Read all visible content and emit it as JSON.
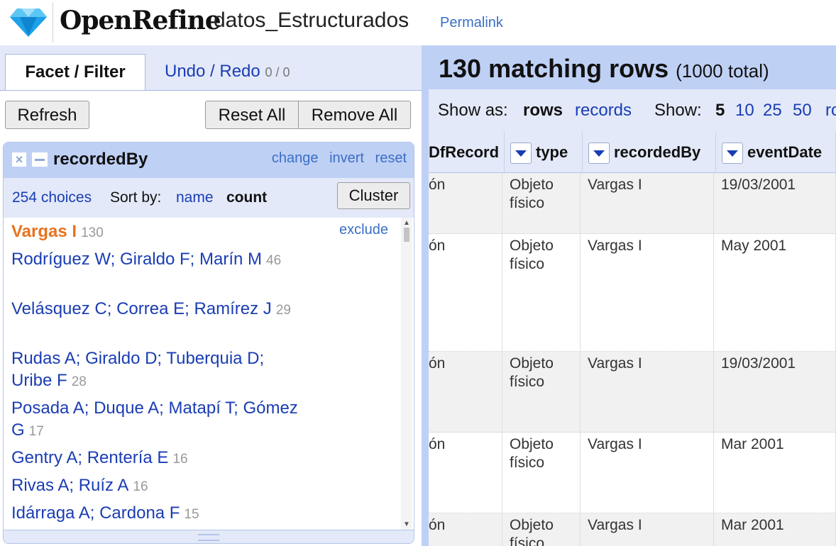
{
  "header": {
    "brand": "OpenRefine",
    "project_name": "datos_Estructurados",
    "permalink": "Permalink"
  },
  "left_panel": {
    "tabs": [
      {
        "label": "Facet / Filter",
        "active": true
      },
      {
        "label": "Undo / Redo",
        "count": "0 / 0",
        "active": false
      }
    ],
    "buttons": {
      "refresh": "Refresh",
      "reset_all": "Reset All",
      "remove_all": "Remove All"
    },
    "facet": {
      "name": "recordedBy",
      "links": [
        "change",
        "invert",
        "reset"
      ],
      "choices_count": "254 choices",
      "sort_label": "Sort by:",
      "sort_name": "name",
      "sort_count": "count",
      "cluster": "Cluster",
      "exclude": "exclude",
      "choices": [
        {
          "label": "Vargas I",
          "count": "130",
          "selected": true
        },
        {
          "label": "Rodríguez W; Giraldo F; Marín M",
          "count": "46"
        },
        {
          "label": "Velásquez C; Correa E; Ramírez J",
          "count": "29"
        },
        {
          "label": "Rudas A; Giraldo D; Tuberquia D; Uribe F",
          "count": "28"
        },
        {
          "label": "Posada A; Duque A; Matapí T; Gómez G",
          "count": "17"
        },
        {
          "label": "Gentry A; Rentería E",
          "count": "16"
        },
        {
          "label": "Rivas A; Ruíz A",
          "count": "16"
        },
        {
          "label": "Idárraga A; Cardona F",
          "count": "15"
        }
      ]
    }
  },
  "right_panel": {
    "summary_count": "130 matching rows",
    "summary_total": "(1000 total)",
    "show_as_label": "Show as:",
    "show_as_rows": "rows",
    "show_as_records": "records",
    "show_label": "Show:",
    "page_sizes": [
      "5",
      "10",
      "25",
      "50",
      "rc"
    ],
    "columns": [
      "DfRecord",
      "type",
      "recordedBy",
      "eventDate"
    ],
    "rows": [
      {
        "c0": "ón",
        "type": "Objeto físico",
        "recordedBy": "Vargas I",
        "eventDate": "19/03/2001"
      },
      {
        "c0": "ón",
        "type": "Objeto físico",
        "recordedBy": "Vargas I",
        "eventDate": "May 2001"
      },
      {
        "c0": "ón",
        "type": "Objeto físico",
        "recordedBy": "Vargas I",
        "eventDate": "19/03/2001"
      },
      {
        "c0": "ón",
        "type": "Objeto físico",
        "recordedBy": "Vargas I",
        "eventDate": "Mar 2001"
      },
      {
        "c0": "ón",
        "type": "Objeto físico",
        "recordedBy": "Vargas I",
        "eventDate": "Mar 2001"
      }
    ]
  }
}
